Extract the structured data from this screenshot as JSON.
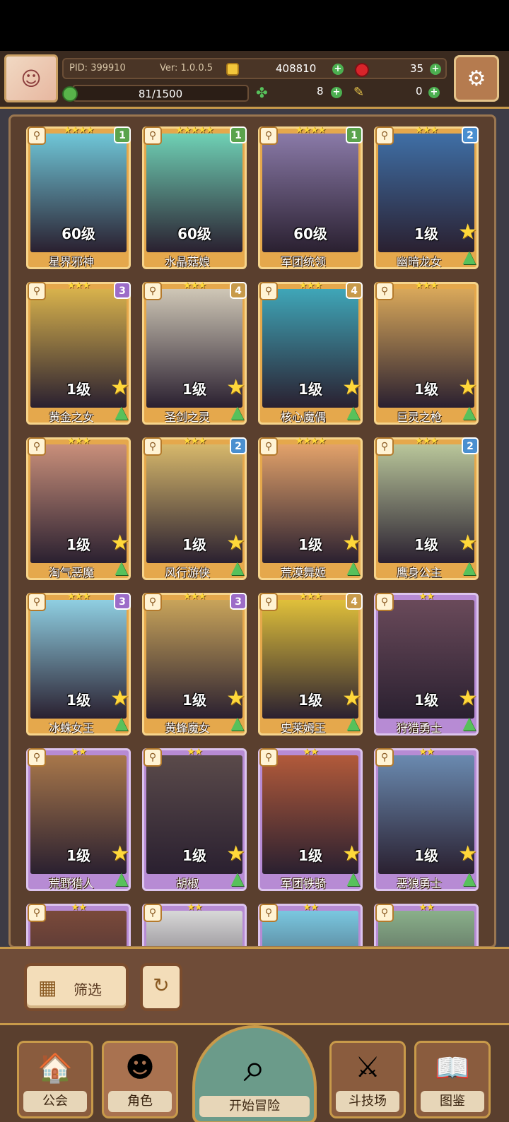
{
  "topbar": {
    "pid": "PID: 399910",
    "version": "Ver: 1.0.0.5",
    "gold": "408810",
    "apples": "35",
    "energy": "81/1500",
    "clovers": "8",
    "feathers": "0"
  },
  "cards": [
    {
      "name": "星界邪神",
      "level": "60级",
      "stars": "★★★★",
      "badge": "1",
      "frame": "gold",
      "badge_color": "#5aa34c",
      "art_color": "#6fc6d8"
    },
    {
      "name": "水晶菇娘",
      "level": "60级",
      "stars": "★★★★★",
      "badge": "1",
      "frame": "gold",
      "badge_color": "#5aa34c",
      "art_color": "#6fd1b5"
    },
    {
      "name": "军团统领",
      "level": "60级",
      "stars": "★★★★",
      "badge": "1",
      "frame": "gold",
      "badge_color": "#5aa34c",
      "art_color": "#8a7aa8"
    },
    {
      "name": "幽暗龙女",
      "level": "1级",
      "stars": "★★★",
      "badge": "2",
      "frame": "gold",
      "badge_color": "#4a8fd0",
      "art_color": "#3f6fa6"
    },
    {
      "name": "黄金之女",
      "level": "1级",
      "stars": "★★★",
      "badge": "3",
      "frame": "gold",
      "badge_color": "#9c6cc8",
      "art_color": "#d8b24c"
    },
    {
      "name": "圣剑之灵",
      "level": "1级",
      "stars": "★★★",
      "badge": "4",
      "frame": "gold",
      "badge_color": "#c89a4a",
      "art_color": "#cfc7b6"
    },
    {
      "name": "核心魔偶",
      "level": "1级",
      "stars": "★★★",
      "badge": "4",
      "frame": "gold",
      "badge_color": "#c89a4a",
      "art_color": "#3fa6b8"
    },
    {
      "name": "巨灵之枪",
      "level": "1级",
      "stars": "★★★",
      "badge": "",
      "frame": "gold",
      "badge_color": "#c89a4a",
      "art_color": "#d9a85a"
    },
    {
      "name": "淘气恶魔",
      "level": "1级",
      "stars": "★★★",
      "badge": "",
      "frame": "gold",
      "badge_color": "#c89a4a",
      "art_color": "#c98f7a"
    },
    {
      "name": "风行游侠",
      "level": "1级",
      "stars": "★★★",
      "badge": "2",
      "frame": "gold",
      "badge_color": "#4a8fd0",
      "art_color": "#d7b86b"
    },
    {
      "name": "荒漠舞姬",
      "level": "1级",
      "stars": "★★★★",
      "badge": "",
      "frame": "gold",
      "badge_color": "#c89a4a",
      "art_color": "#e3a26a"
    },
    {
      "name": "鹰身公主",
      "level": "1级",
      "stars": "★★★",
      "badge": "2",
      "frame": "gold",
      "badge_color": "#4a8fd0",
      "art_color": "#b9c69a"
    },
    {
      "name": "冰蛛女王",
      "level": "1级",
      "stars": "★★★",
      "badge": "3",
      "frame": "gold",
      "badge_color": "#9c6cc8",
      "art_color": "#8fcfe2"
    },
    {
      "name": "黄蜂魔女",
      "level": "1级",
      "stars": "★★★",
      "badge": "3",
      "frame": "gold",
      "badge_color": "#9c6cc8",
      "art_color": "#c9a45a"
    },
    {
      "name": "史莱姆王",
      "level": "1级",
      "stars": "★★★",
      "badge": "4",
      "frame": "gold",
      "badge_color": "#c89a4a",
      "art_color": "#e0c03a"
    },
    {
      "name": "狩猎勇士",
      "level": "1级",
      "stars": "★★",
      "badge": "",
      "frame": "purple",
      "badge_color": "#9c6cc8",
      "art_color": "#6a4a5a"
    },
    {
      "name": "荒野猎人",
      "level": "1级",
      "stars": "★★",
      "badge": "",
      "frame": "purple",
      "badge_color": "#9c6cc8",
      "art_color": "#a8774a"
    },
    {
      "name": "胡椒",
      "level": "1级",
      "stars": "★★",
      "badge": "",
      "frame": "purple",
      "badge_color": "#9c6cc8",
      "art_color": "#5a4a4a"
    },
    {
      "name": "军团铁骑",
      "level": "1级",
      "stars": "★★",
      "badge": "",
      "frame": "purple",
      "badge_color": "#9c6cc8",
      "art_color": "#b25a3a"
    },
    {
      "name": "恶狼勇士",
      "level": "1级",
      "stars": "★★",
      "badge": "",
      "frame": "purple",
      "badge_color": "#9c6cc8",
      "art_color": "#6a8ab0"
    },
    {
      "name": "",
      "level": "",
      "stars": "★★",
      "badge": "",
      "frame": "purple",
      "badge_color": "#9c6cc8",
      "art_color": "#7a4a3a"
    },
    {
      "name": "",
      "level": "",
      "stars": "★★",
      "badge": "",
      "frame": "purple",
      "badge_color": "#9c6cc8",
      "art_color": "#d8d8d8"
    },
    {
      "name": "",
      "level": "",
      "stars": "★★",
      "badge": "",
      "frame": "purple",
      "badge_color": "#9c6cc8",
      "art_color": "#7ac8e0"
    },
    {
      "name": "",
      "level": "",
      "stars": "★★",
      "badge": "",
      "frame": "purple",
      "badge_color": "#9c6cc8",
      "art_color": "#8ab08a"
    }
  ],
  "filter": {
    "label": "筛选"
  },
  "nav": {
    "guild": "公会",
    "character": "角色",
    "adventure": "开始冒险",
    "arena": "斗技场",
    "codex": "图鉴"
  }
}
